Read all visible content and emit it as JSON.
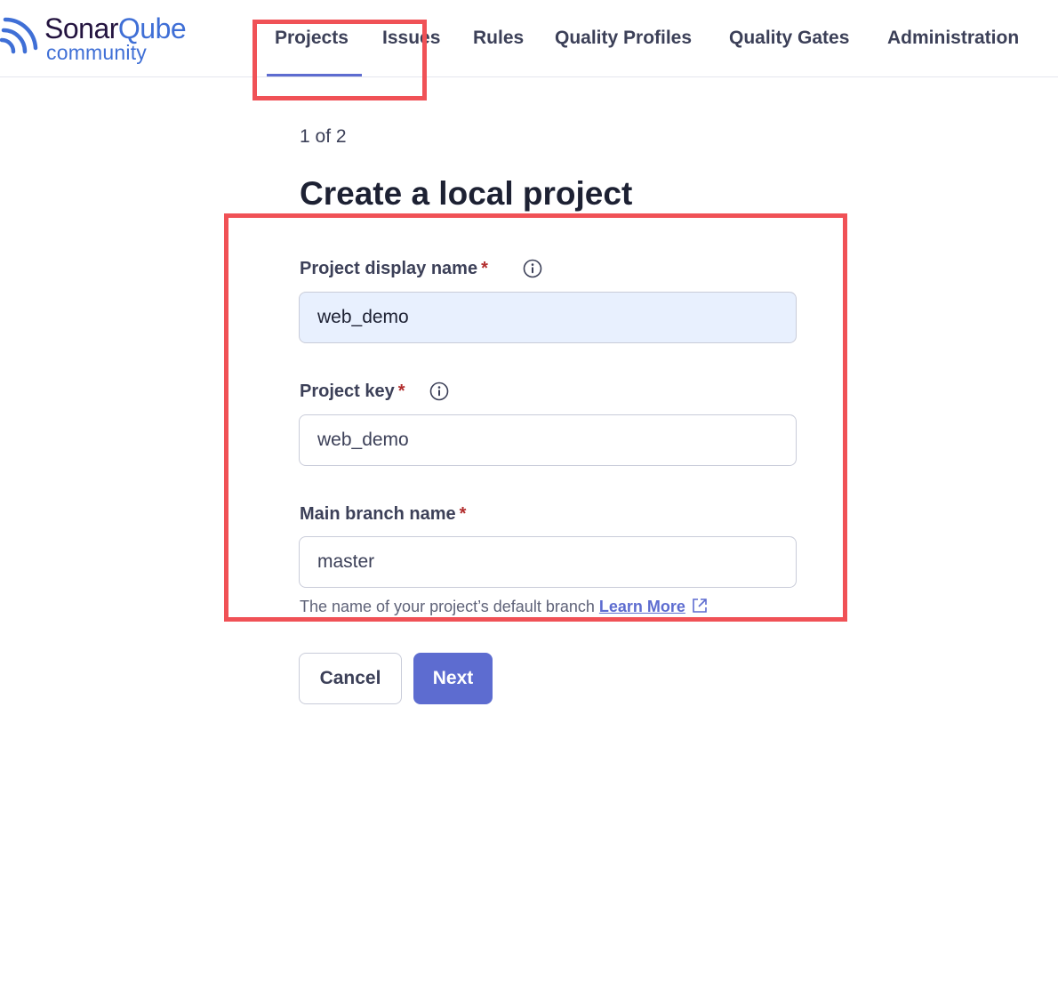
{
  "header": {
    "logo_word_1": "Sonar",
    "logo_word_2": "Qube",
    "logo_sub": "community",
    "nav": [
      "Projects",
      "Issues",
      "Rules",
      "Quality Profiles",
      "Quality Gates",
      "Administration"
    ],
    "active_nav": "Projects"
  },
  "main": {
    "step": "1 of 2",
    "title": "Create a local project",
    "fields": {
      "display_name": {
        "label": "Project display name",
        "required": "*",
        "value": "web_demo"
      },
      "project_key": {
        "label": "Project key",
        "required": "*",
        "value": "web_demo"
      },
      "branch": {
        "label": "Main branch name",
        "required": "*",
        "value": "master",
        "helper": "The name of your project’s default branch",
        "link": "Learn More"
      }
    },
    "buttons": {
      "cancel": "Cancel",
      "next": "Next"
    }
  },
  "colors": {
    "accent": "#5d6cd0",
    "annotation": "#f05156",
    "autofill": "#e8f0fe",
    "required": "#b22d2d"
  }
}
